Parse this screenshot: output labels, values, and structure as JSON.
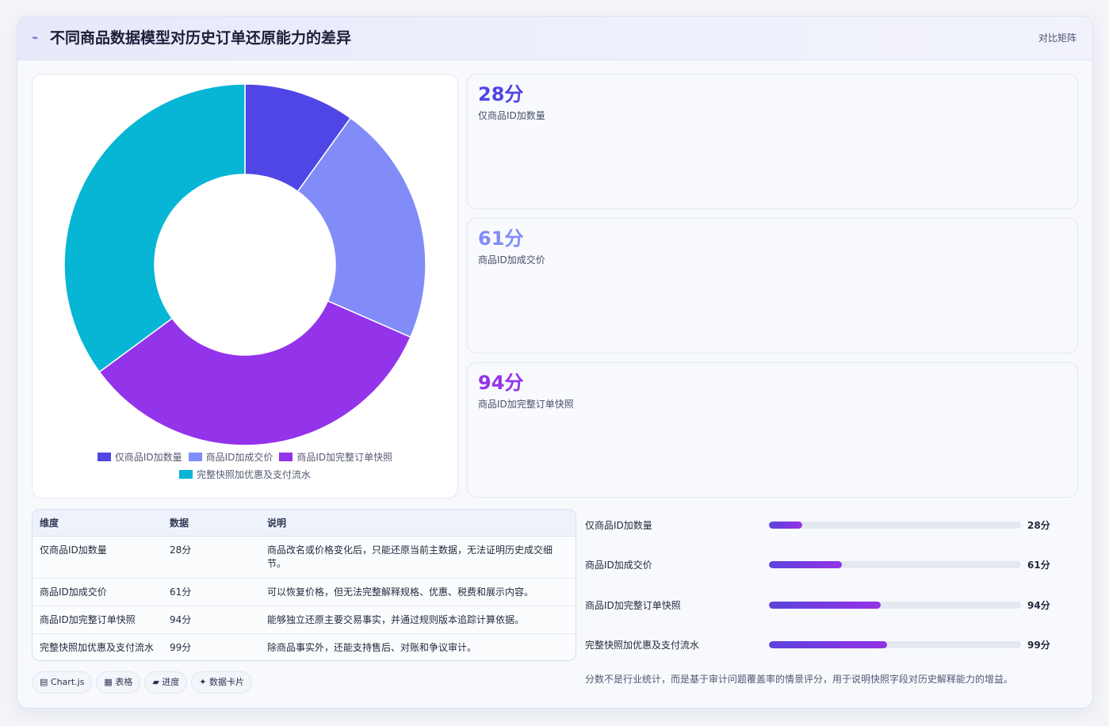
{
  "header": {
    "icon": "sparkline-icon",
    "title": "不同商品数据模型对历史订单还原能力的差异",
    "right_label": "对比矩阵"
  },
  "chart_data": {
    "type": "pie",
    "donut": true,
    "categories": [
      "仅商品ID加数量",
      "商品ID加成交价",
      "商品ID加完整订单快照",
      "完整快照加优惠及支付流水"
    ],
    "values": [
      28,
      61,
      94,
      99
    ],
    "colors": [
      "#4f46e5",
      "#818cf8",
      "#9333ea",
      "#06b6d4"
    ],
    "legend_position": "bottom"
  },
  "kpis": [
    {
      "value": "28分",
      "label": "仅商品ID加数量",
      "color": "#4f46e5"
    },
    {
      "value": "61分",
      "label": "商品ID加成交价",
      "color": "#818cf8"
    },
    {
      "value": "94分",
      "label": "商品ID加完整订单快照",
      "color": "#9333ea"
    }
  ],
  "table": {
    "headers": [
      "维度",
      "数据",
      "说明"
    ],
    "rows": [
      [
        "仅商品ID加数量",
        "28分",
        "商品改名或价格变化后，只能还原当前主数据，无法证明历史成交细节。"
      ],
      [
        "商品ID加成交价",
        "61分",
        "可以恢复价格，但无法完整解释规格、优惠、税费和展示内容。"
      ],
      [
        "商品ID加完整订单快照",
        "94分",
        "能够独立还原主要交易事实，并通过规则版本追踪计算依据。"
      ],
      [
        "完整快照加优惠及支付流水",
        "99分",
        "除商品事实外，还能支持售后、对账和争议审计。"
      ]
    ]
  },
  "progress": [
    {
      "label": "仅商品ID加数量",
      "value": 28,
      "value_label": "28分"
    },
    {
      "label": "商品ID加成交价",
      "value": 61,
      "value_label": "61分"
    },
    {
      "label": "商品ID加完整订单快照",
      "value": 94,
      "value_label": "94分"
    },
    {
      "label": "完整快照加优惠及支付流水",
      "value": 99,
      "value_label": "99分"
    }
  ],
  "progress_scale_max": 212,
  "footnote": "分数不是行业统计，而是基于审计问题覆盖率的情景评分，用于说明快照字段对历史解释能力的增益。",
  "tags": [
    {
      "icon": "▤",
      "label": "Chart.js"
    },
    {
      "icon": "▦",
      "label": "表格"
    },
    {
      "icon": "▰",
      "label": "进度"
    },
    {
      "icon": "✦",
      "label": "数据卡片"
    }
  ]
}
